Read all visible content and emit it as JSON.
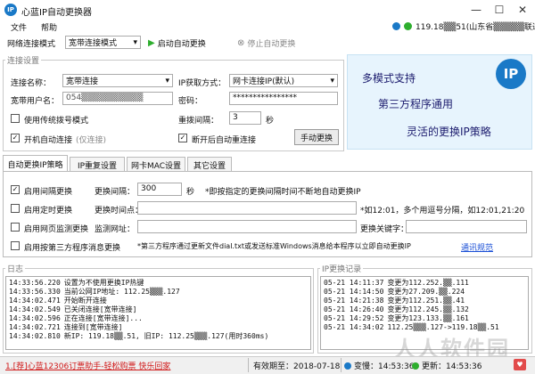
{
  "window": {
    "title": "心蓝IP自动更换器",
    "app_icon": "IP",
    "controls": [
      "—",
      "☐",
      "✕"
    ]
  },
  "menu": {
    "items": [
      "文件",
      "帮助"
    ],
    "ip_status": "119.18▒▒51(山东省▒▒▒▒▒联通)"
  },
  "toolbar": {
    "mode_label": "网络连接模式",
    "mode_value": "宽带连接模式",
    "start_label": "启动自动更换",
    "stop_label": "停止自动更换"
  },
  "connection_settings": {
    "group_title": "连接设置",
    "conn_name_label": "连接名称：",
    "conn_name_value": "宽带连接",
    "ip_method_label": "IP获取方式：",
    "ip_method_value": "网卡连接IP(默认)",
    "account_label": "宽带用户名：",
    "account_value": "054▒▒▒▒▒▒▒▒▒▒",
    "password_label": "密码：",
    "password_value": "****************",
    "legacy_dial_label": "使用传统拨号模式",
    "retry_label": "重拨间隔：",
    "retry_value": "3",
    "retry_unit": "秒",
    "auto_connect_label": "开机自动连接",
    "auto_connect_hint": "(仅连接)",
    "reconnect_label": "断开后自动重连接",
    "manual_button": "手动更换"
  },
  "banner": {
    "line1": "多模式支持",
    "line2": "第三方程序通用",
    "line3": "灵活的更换IP策略",
    "logo_text": "IP"
  },
  "tabs": [
    "自动更换IP策略",
    "IP重复设置",
    "网卡MAC设置",
    "其它设置"
  ],
  "strategy": {
    "interval_label": "启用间隔更换",
    "interval_field_label": "更换间隔：",
    "interval_value": "300",
    "interval_unit": "秒",
    "interval_hint": "*即按指定的更换间隔时间不断地自动更换IP",
    "timed_label": "启用定时更换",
    "timed_field_label": "更换时间点：",
    "timed_hint": "*如12:01，多个用逗号分隔，如12:01,21:20",
    "web_label": "启用网页监测更换",
    "web_field_label": "监测网址：",
    "keyword_label": "更换关键字：",
    "third_label": "启用按第三方程序消息更换",
    "third_hint": "*第三方程序通过更新文件dial.txt或发送标准Windows消息给本程序以立即自动更换IP",
    "detail_link": "通讯规范"
  },
  "log": {
    "title": "日志",
    "lines": [
      {
        "time": "14:33:56.220",
        "msg": "设置为不使用更换IP热键"
      },
      {
        "time": "14:33:56.330",
        "msg": "当前公网IP地址: 112.25▒▒▒.127"
      },
      {
        "time": "14:34:02.471",
        "msg": "开始断开连接"
      },
      {
        "time": "14:34:02.549",
        "msg": "已关闭连接[宽带连接]"
      },
      {
        "time": "14:34:02.596",
        "msg": "正在连接[宽带连接]..."
      },
      {
        "time": "14:34:02.721",
        "msg": "连接到[宽带连接]"
      },
      {
        "time": "14:34:02.810",
        "msg": "新IP: 119.18▒▒.51, 旧IP: 112.25▒▒▒.127(用时360ms)"
      }
    ]
  },
  "ip_log": {
    "title": "IP更换记录",
    "lines": [
      {
        "time": "05-21 14:11:37",
        "msg": "变更为112.252.▒▒.111"
      },
      {
        "time": "05-21 14:14:50",
        "msg": "变更为27.209.▒▒.224"
      },
      {
        "time": "05-21 14:21:38",
        "msg": "变更为112.251.▒▒.41"
      },
      {
        "time": "05-21 14:26:40",
        "msg": "变更为112.245.▒▒.132"
      },
      {
        "time": "05-21 14:29:52",
        "msg": "变更为123.133.▒▒.161"
      },
      {
        "time": "05-21 14:34:02",
        "msg": "112.25▒▒▒.127->119.18▒▒.51"
      }
    ]
  },
  "statusbar": {
    "promo": "1.[荐]心蓝12306订票助手-轻松购票 快乐回家",
    "expiry_label": "有效期至：2018-07-18",
    "time1_label": "变慢：14:53:36",
    "time2_label": "更新：14:53:36"
  },
  "watermark": "人人软件园",
  "colors": {
    "accent": "#1a79c7",
    "banner_bg": "#e7f4fd",
    "banner_text": "#1c1c6e",
    "promo_red": "#d01818",
    "start_green": "#2eae2e",
    "status_blue": "#1a79c7",
    "status_green": "#2eae2e"
  }
}
